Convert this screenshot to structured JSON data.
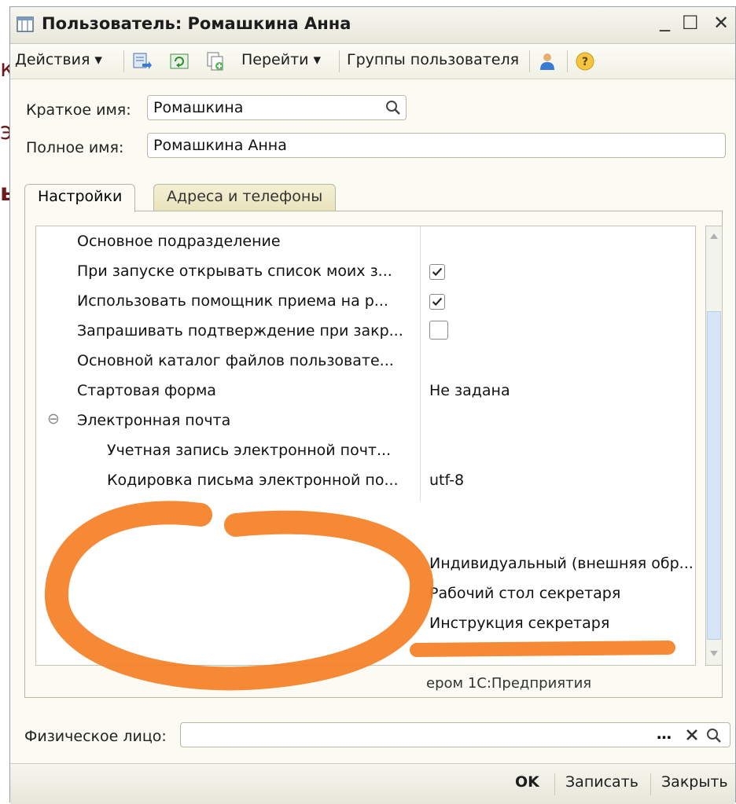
{
  "background_fragments": [
    "к",
    "э",
    "ь"
  ],
  "window": {
    "title": "Пользователь: Ромашкина Анна",
    "controls": {
      "minimize": "_",
      "maximize": "☐",
      "close": "✕"
    }
  },
  "toolbar": {
    "actions": "Действия ▾",
    "goto": "Перейти ▾",
    "user_groups": "Группы пользователя"
  },
  "form": {
    "short_name_label": "Краткое имя:",
    "short_name_value": "Ромашкина",
    "full_name_label": "Полное имя:",
    "full_name_value": "Ромашкина Анна",
    "person_label": "Физическое лицо:",
    "person_value": ""
  },
  "tabs": [
    {
      "label": "Настройки",
      "active": true
    },
    {
      "label": "Адреса и телефоны",
      "active": false
    }
  ],
  "settings": {
    "rows": [
      {
        "label": "Основное подразделение",
        "value": ""
      },
      {
        "label": "При запуске открывать список моих з...",
        "checked": true
      },
      {
        "label": "Использовать помощник приема на р...",
        "checked": true
      },
      {
        "label": "Запрашивать подтверждение при закр...",
        "checked": false
      },
      {
        "label": "Основной каталог файлов пользовате...",
        "value": ""
      },
      {
        "label": "Стартовая форма",
        "value": "Не задана"
      },
      {
        "label": "Электронная почта",
        "group": true,
        "expanded_symbol": "⊖"
      },
      {
        "label": "Учетная запись электронной почт...",
        "value": ""
      },
      {
        "label": "Кодировка письма электронной по...",
        "value": "utf-8"
      }
    ],
    "extra_values": [
      "Индивидуальный (внешняя обр...",
      "Рабочий стол секретаря",
      "Инструкция секретаря",
      "ером 1С:Предприятия"
    ]
  },
  "footer": {
    "ok": "OK",
    "save": "Записать",
    "close": "Закрыть"
  },
  "colors": {
    "annotation": "#f47c20",
    "tab_inactive": "#ece6c2",
    "scroll_thumb": "#d6e5f7"
  }
}
